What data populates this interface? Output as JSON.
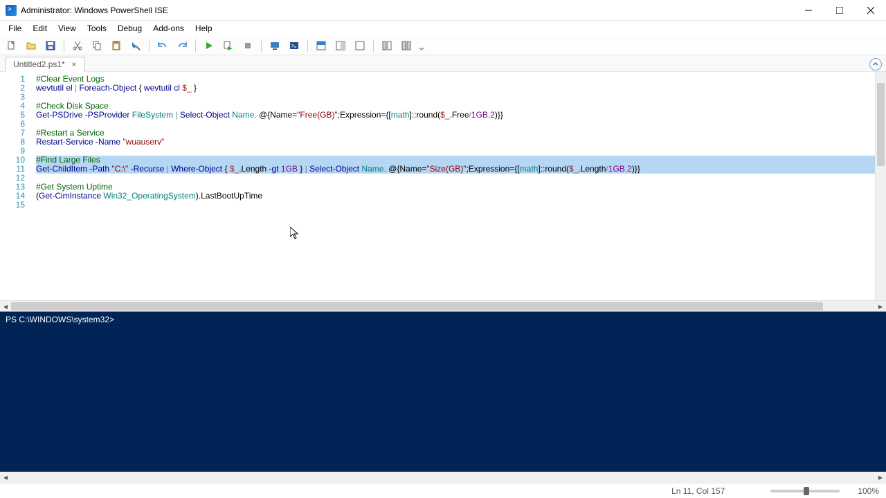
{
  "window": {
    "title": "Administrator: Windows PowerShell ISE"
  },
  "menu": [
    "File",
    "Edit",
    "View",
    "Tools",
    "Debug",
    "Add-ons",
    "Help"
  ],
  "tab": {
    "label": "Untitled2.ps1*"
  },
  "code_lines": [
    {
      "n": 1,
      "sel": false,
      "tokens": [
        [
          "c-cmt",
          "#Clear Event Logs"
        ]
      ]
    },
    {
      "n": 2,
      "sel": false,
      "tokens": [
        [
          "c-cmd",
          "wevtutil"
        ],
        [
          "c-text",
          " "
        ],
        [
          "c-cmd",
          "el"
        ],
        [
          "c-text",
          " "
        ],
        [
          "c-op",
          "|"
        ],
        [
          "c-text",
          " "
        ],
        [
          "c-cmd",
          "Foreach-Object"
        ],
        [
          "c-text",
          " { "
        ],
        [
          "c-cmd",
          "wevtutil"
        ],
        [
          "c-text",
          " "
        ],
        [
          "c-cmd",
          "cl"
        ],
        [
          "c-text",
          " "
        ],
        [
          "c-var",
          "$_"
        ],
        [
          "c-text",
          " }"
        ]
      ]
    },
    {
      "n": 3,
      "sel": false,
      "tokens": []
    },
    {
      "n": 4,
      "sel": false,
      "tokens": [
        [
          "c-cmt",
          "#Check Disk Space"
        ]
      ]
    },
    {
      "n": 5,
      "sel": false,
      "tokens": [
        [
          "c-cmd",
          "Get-PSDrive"
        ],
        [
          "c-text",
          " "
        ],
        [
          "c-par",
          "-PSProvider"
        ],
        [
          "c-text",
          " "
        ],
        [
          "c-type",
          "FileSystem"
        ],
        [
          "c-text",
          " "
        ],
        [
          "c-op",
          "|"
        ],
        [
          "c-text",
          " "
        ],
        [
          "c-cmd",
          "Select-Object"
        ],
        [
          "c-text",
          " "
        ],
        [
          "c-type",
          "Name"
        ],
        [
          "c-op",
          ","
        ],
        [
          "c-text",
          " @{Name="
        ],
        [
          "c-str",
          "\"Free(GB)\""
        ],
        [
          "c-text",
          ";Expression={["
        ],
        [
          "c-type",
          "math"
        ],
        [
          "c-text",
          "]::round("
        ],
        [
          "c-var",
          "$_"
        ],
        [
          "c-text",
          ".Free"
        ],
        [
          "c-op",
          "/"
        ],
        [
          "c-num",
          "1GB"
        ],
        [
          "c-op",
          ","
        ],
        [
          "c-num",
          "2"
        ],
        [
          "c-text",
          ")}}"
        ]
      ]
    },
    {
      "n": 6,
      "sel": false,
      "tokens": []
    },
    {
      "n": 7,
      "sel": false,
      "tokens": [
        [
          "c-cmt",
          "#Restart a Service"
        ]
      ]
    },
    {
      "n": 8,
      "sel": false,
      "tokens": [
        [
          "c-cmd",
          "Restart-Service"
        ],
        [
          "c-text",
          " "
        ],
        [
          "c-par",
          "-Name"
        ],
        [
          "c-text",
          " "
        ],
        [
          "c-str",
          "\"wuauserv\""
        ]
      ]
    },
    {
      "n": 9,
      "sel": false,
      "tokens": []
    },
    {
      "n": 10,
      "sel": true,
      "tokens": [
        [
          "c-cmt",
          "#Find Large Files"
        ]
      ]
    },
    {
      "n": 11,
      "sel": true,
      "tokens": [
        [
          "c-cmd",
          "Get-ChildItem"
        ],
        [
          "c-text",
          " "
        ],
        [
          "c-par",
          "-Path"
        ],
        [
          "c-text",
          " "
        ],
        [
          "c-str",
          "\"C:\\\""
        ],
        [
          "c-text",
          " "
        ],
        [
          "c-par",
          "-Recurse"
        ],
        [
          "c-text",
          " "
        ],
        [
          "c-op",
          "|"
        ],
        [
          "c-text",
          " "
        ],
        [
          "c-cmd",
          "Where-Object"
        ],
        [
          "c-text",
          " { "
        ],
        [
          "c-var",
          "$_"
        ],
        [
          "c-text",
          ".Length "
        ],
        [
          "c-par",
          "-gt"
        ],
        [
          "c-text",
          " "
        ],
        [
          "c-num",
          "1GB"
        ],
        [
          "c-text",
          " } "
        ],
        [
          "c-op",
          "|"
        ],
        [
          "c-text",
          " "
        ],
        [
          "c-cmd",
          "Select-Object"
        ],
        [
          "c-text",
          " "
        ],
        [
          "c-type",
          "Name"
        ],
        [
          "c-op",
          ","
        ],
        [
          "c-text",
          " @{Name="
        ],
        [
          "c-str",
          "\"Size(GB)\""
        ],
        [
          "c-text",
          ";Expression={["
        ],
        [
          "c-type",
          "math"
        ],
        [
          "c-text",
          "]::round("
        ],
        [
          "c-var",
          "$_"
        ],
        [
          "c-text",
          ".Length"
        ],
        [
          "c-op",
          "/"
        ],
        [
          "c-num",
          "1GB"
        ],
        [
          "c-op",
          ","
        ],
        [
          "c-num",
          "2"
        ],
        [
          "c-text",
          ")}}"
        ]
      ]
    },
    {
      "n": 12,
      "sel": false,
      "tokens": []
    },
    {
      "n": 13,
      "sel": false,
      "tokens": [
        [
          "c-cmt",
          "#Get System Uptime"
        ]
      ]
    },
    {
      "n": 14,
      "sel": false,
      "tokens": [
        [
          "c-text",
          "("
        ],
        [
          "c-cmd",
          "Get-CimInstance"
        ],
        [
          "c-text",
          " "
        ],
        [
          "c-type",
          "Win32_OperatingSystem"
        ],
        [
          "c-text",
          ").LastBootUpTime"
        ]
      ]
    },
    {
      "n": 15,
      "sel": false,
      "tokens": []
    }
  ],
  "console": {
    "prompt": "PS C:\\WINDOWS\\system32> "
  },
  "status": {
    "position": "Ln 11, Col 157",
    "zoom": "100%"
  },
  "toolbar_buttons": [
    "new-file",
    "open-file",
    "save-file",
    "sep",
    "cut",
    "copy",
    "paste",
    "sep",
    "undo",
    "redo",
    "sep",
    "run-script",
    "run-selection",
    "stop",
    "sep",
    "remote",
    "new-remote-tab",
    "sep",
    "show-script",
    "show-script-right",
    "show-script-max",
    "sep",
    "show-command",
    "show-command-addon",
    "options-dropdown"
  ]
}
